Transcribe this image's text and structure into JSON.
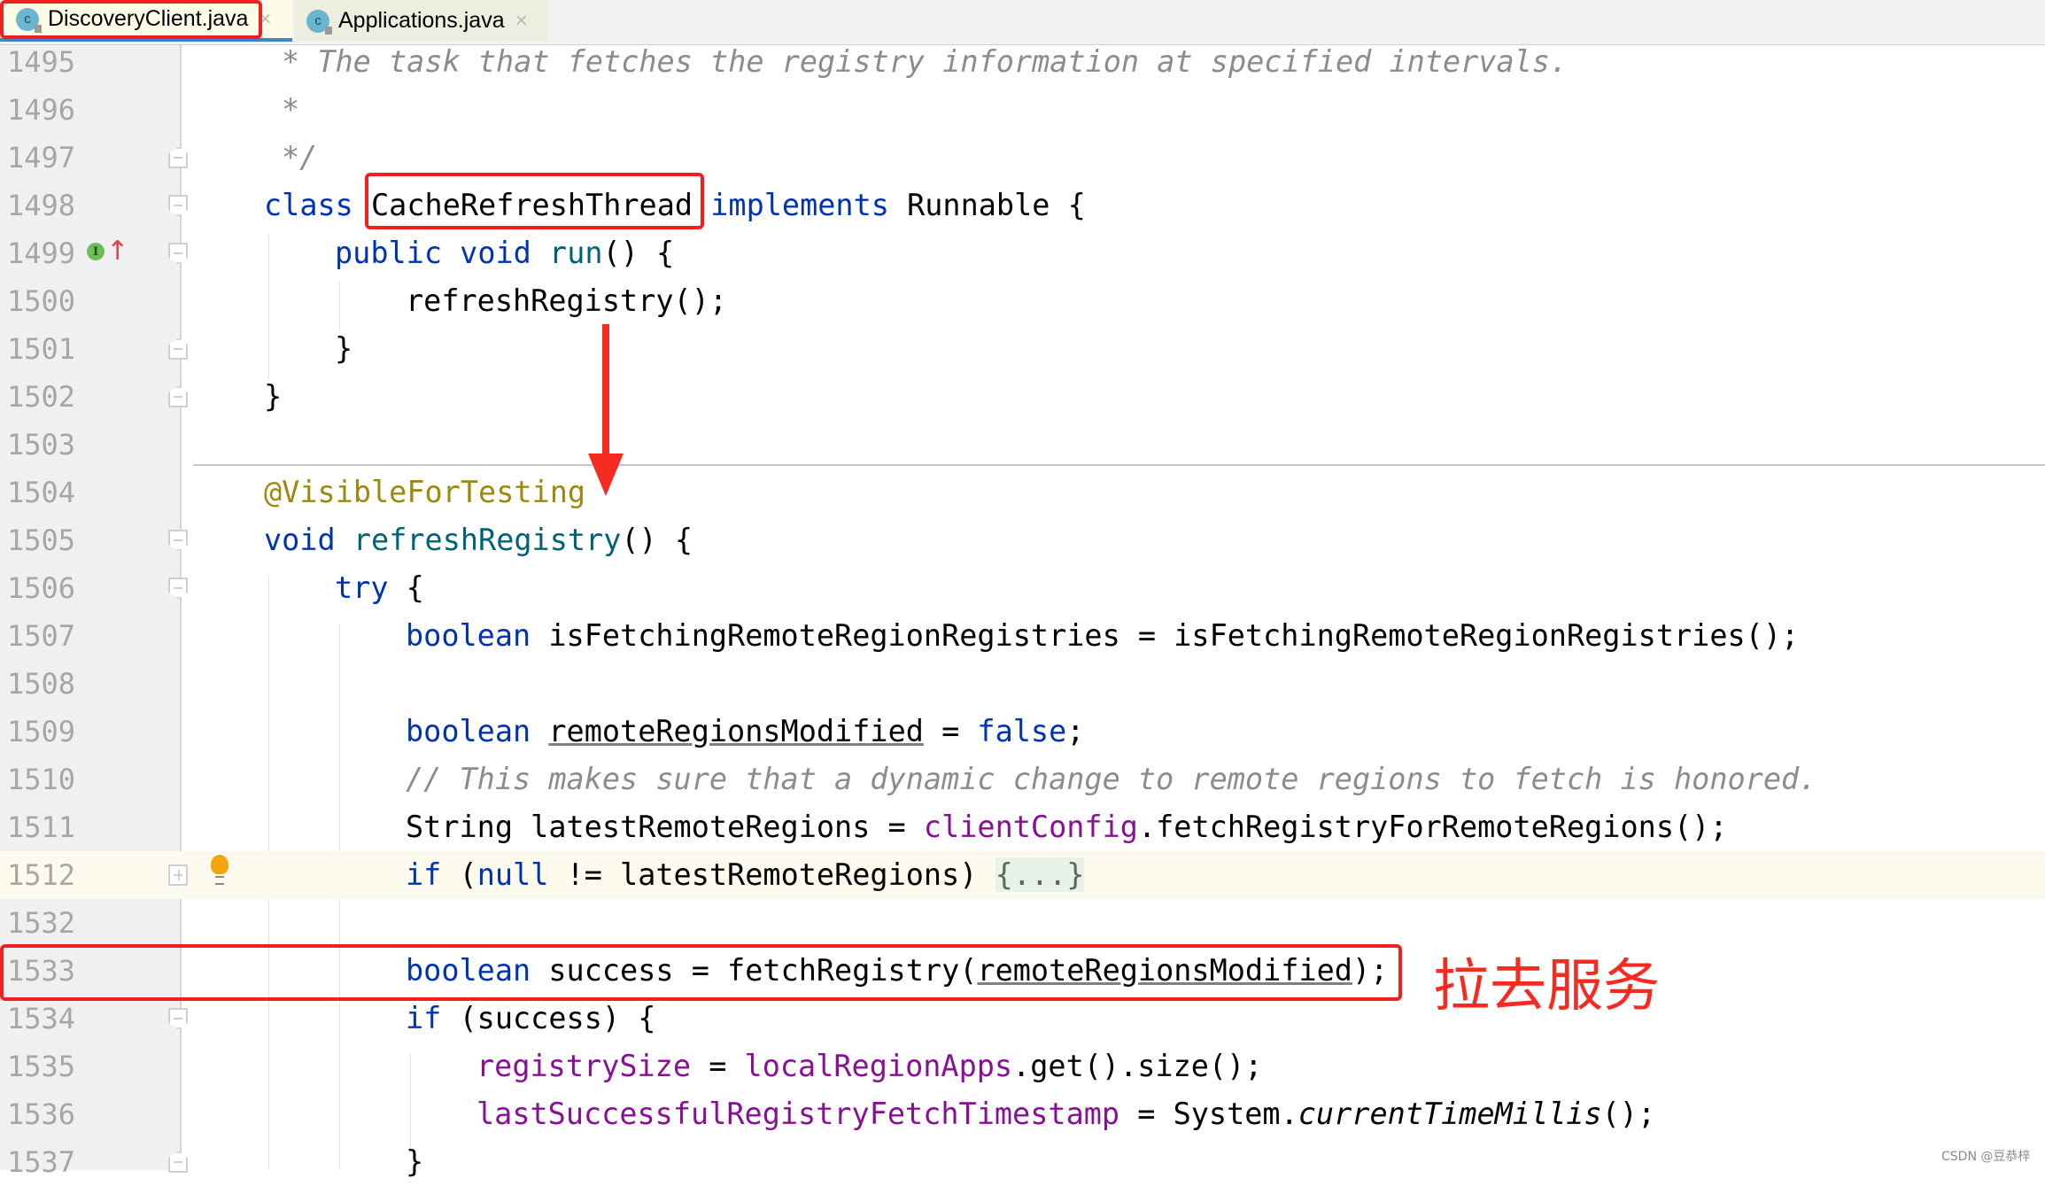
{
  "tabs": [
    {
      "label": "DiscoveryClient.java",
      "icon": "java-class-icon",
      "active": true
    },
    {
      "label": "Applications.java",
      "icon": "java-class-icon",
      "active": false
    }
  ],
  "tab_close_glyph": "×",
  "class_icon_letter": "c",
  "lines": [
    {
      "num": "1495",
      "text": "* The task that fetches the registry information at specified intervals."
    },
    {
      "num": "1496",
      "text": "*"
    },
    {
      "num": "1497",
      "text": "*/"
    },
    {
      "num": "1498",
      "kw1": "class",
      "name": "CacheRefreshThread",
      "kw2": "implements",
      "rest": "Runnable {"
    },
    {
      "num": "1499",
      "kw1": "public void",
      "fn": "run",
      "rest": "() {"
    },
    {
      "num": "1500",
      "text": "refreshRegistry();"
    },
    {
      "num": "1501",
      "text": "}"
    },
    {
      "num": "1502",
      "text": "}"
    },
    {
      "num": "1503",
      "text": ""
    },
    {
      "num": "1504",
      "text": "@VisibleForTesting"
    },
    {
      "num": "1505",
      "kw1": "void",
      "fn": "refreshRegistry",
      "rest": "() {"
    },
    {
      "num": "1506",
      "kw1": "try",
      "rest": " {"
    },
    {
      "num": "1507",
      "kw1": "boolean",
      "rest": " isFetchingRemoteRegionRegistries = isFetchingRemoteRegionRegistries();"
    },
    {
      "num": "1508",
      "text": ""
    },
    {
      "num": "1509",
      "kw1": "boolean",
      "var": "remoteRegionsModified",
      "mid": " = ",
      "kw2": "false",
      "rest": ";"
    },
    {
      "num": "1510",
      "text": "// This makes sure that a dynamic change to remote regions to fetch is honored."
    },
    {
      "num": "1511",
      "pre": "String latestRemoteRegions = ",
      "fld": "clientConfig",
      "rest": ".fetchRegistryForRemoteRegions();"
    },
    {
      "num": "1512",
      "kw1": "if",
      "mid": " (",
      "kw2": "null",
      "rest": " != latestRemoteRegions) ",
      "folded": "{...}"
    },
    {
      "num": "1532",
      "text": ""
    },
    {
      "num": "1533",
      "kw1": "boolean",
      "pre": " success = fetchRegistry(",
      "var": "remoteRegionsModified",
      "rest": ");"
    },
    {
      "num": "1534",
      "kw1": "if",
      "rest": " (success) {"
    },
    {
      "num": "1535",
      "fld": "registrySize",
      "mid": " = ",
      "fld2": "localRegionApps",
      "rest": ".get().size();"
    },
    {
      "num": "1536",
      "fld": "lastSuccessfulRegistryFetchTimestamp",
      "mid": " = System.",
      "it": "currentTimeMillis",
      "rest": "();"
    },
    {
      "num": "1537",
      "text": "}"
    }
  ],
  "annotation": {
    "label": "拉去服务",
    "color": "#f52a20"
  },
  "watermark": "CSDN @豆恭梓",
  "colors": {
    "keyword": "#0033b3",
    "function": "#00627a",
    "field": "#871094",
    "comment": "#8c8c8c",
    "annotation": "#9e880d",
    "highlight_red": "#f02020"
  }
}
